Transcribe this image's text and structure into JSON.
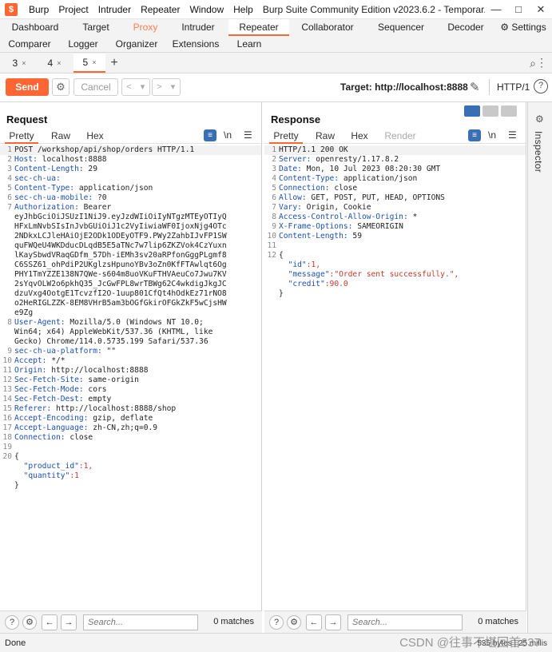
{
  "titlebar": {
    "logo": "$",
    "menu": [
      "Burp",
      "Project",
      "Intruder",
      "Repeater",
      "Window",
      "Help"
    ],
    "title": "Burp Suite Community Edition v2023.6.2 - Temporar...",
    "controls": [
      "—",
      "□",
      "✕"
    ]
  },
  "tool_tabs": {
    "row1": [
      "Dashboard",
      "Target",
      "Proxy",
      "Intruder",
      "Repeater",
      "Collaborator",
      "Sequencer",
      "Decoder",
      "Settings"
    ],
    "row2": [
      "Comparer",
      "Logger",
      "Organizer",
      "Extensions",
      "Learn"
    ],
    "active": "Repeater",
    "highlight": "Proxy",
    "accent_color": "#ff6633"
  },
  "session_tabs": {
    "tabs": [
      {
        "label": "3",
        "close": "×"
      },
      {
        "label": "4",
        "close": "×"
      },
      {
        "label": "5",
        "close": "×"
      }
    ],
    "active": "5",
    "add": "+"
  },
  "toolbar": {
    "send": "Send",
    "cancel": "Cancel",
    "target": "Target: http://localhost:8888",
    "http_version": "HTTP/1",
    "help": "?"
  },
  "request": {
    "title": "Request",
    "subtabs": [
      "Pretty",
      "Raw",
      "Hex"
    ],
    "active_subtab": "Pretty",
    "newline_toggle": "\\n",
    "lines": [
      {
        "n": "1",
        "k": "",
        "v": "POST /workshop/api/shop/orders HTTP/1.1"
      },
      {
        "n": "2",
        "k": "Host:",
        "v": " localhost:8888"
      },
      {
        "n": "3",
        "k": "Content-Length:",
        "v": " 29"
      },
      {
        "n": "4",
        "k": "sec-ch-ua:",
        "v": ""
      },
      {
        "n": "5",
        "k": "Content-Type:",
        "v": " application/json"
      },
      {
        "n": "6",
        "k": "sec-ch-ua-mobile:",
        "v": " ?0"
      },
      {
        "n": "7",
        "k": "Authorization:",
        "v": " Bearer"
      },
      {
        "n": "",
        "k": "",
        "v": "eyJhbGciOiJSUzI1NiJ9.eyJzdWIiOiIyNTgzMTEyOTIyQ"
      },
      {
        "n": "",
        "k": "",
        "v": "HFxLmNvbSIsInJvbGUiOiJ1c2VyIiwiaWF0IjoxNjg4OTc"
      },
      {
        "n": "",
        "k": "",
        "v": "2NDkxLCJleHAiOjE2ODk1ODEyOTF9.PWy2ZahbIJvFP1SW"
      },
      {
        "n": "",
        "k": "",
        "v": "quFWQeU4WKDducDLqdB5E5aTNc7w7lip6ZKZVok4CzYuxn"
      },
      {
        "n": "",
        "k": "",
        "v": "lKaySbwdVRaqGDfm_57Dh-iEMh3sv20aRPfonGggPLgmf8"
      },
      {
        "n": "",
        "k": "",
        "v": "C6SSZ61_ohPdiP2UKglzsHpunoYBv3oZn0KfFTAwlqt6Og"
      },
      {
        "n": "",
        "k": "",
        "v": "PHY1TmYZZE138N7QWe-s604m8uoVKuFTHVAeuCo7Jwu7KV"
      },
      {
        "n": "",
        "k": "",
        "v": "2sYqvOLW2o6pkhQ35_JcGwFPL8wrTBWg62C4wkdigJkgJC"
      },
      {
        "n": "",
        "k": "",
        "v": "dzuVxg4OotgE1TcvzfI2O-1uup801CfQt4hOdkEz71rNO8"
      },
      {
        "n": "",
        "k": "",
        "v": "o2HeRIGLZZK-8EM8VHrB5am3bOGfGkirOFGkZkF5wCjsHW"
      },
      {
        "n": "",
        "k": "",
        "v": "e9Zg"
      },
      {
        "n": "8",
        "k": "User-Agent:",
        "v": " Mozilla/5.0 (Windows NT 10.0;"
      },
      {
        "n": "",
        "k": "",
        "v": "Win64; x64) AppleWebKit/537.36 (KHTML, like"
      },
      {
        "n": "",
        "k": "",
        "v": "Gecko) Chrome/114.0.5735.199 Safari/537.36"
      },
      {
        "n": "9",
        "k": "sec-ch-ua-platform:",
        "v": " \"\""
      },
      {
        "n": "10",
        "k": "Accept:",
        "v": " */*"
      },
      {
        "n": "11",
        "k": "Origin:",
        "v": " http://localhost:8888"
      },
      {
        "n": "12",
        "k": "Sec-Fetch-Site:",
        "v": " same-origin"
      },
      {
        "n": "13",
        "k": "Sec-Fetch-Mode:",
        "v": " cors"
      },
      {
        "n": "14",
        "k": "Sec-Fetch-Dest:",
        "v": " empty"
      },
      {
        "n": "15",
        "k": "Referer:",
        "v": " http://localhost:8888/shop"
      },
      {
        "n": "16",
        "k": "Accept-Encoding:",
        "v": " gzip, deflate"
      },
      {
        "n": "17",
        "k": "Accept-Language:",
        "v": " zh-CN,zh;q=0.9"
      },
      {
        "n": "18",
        "k": "Connection:",
        "v": " close"
      },
      {
        "n": "19",
        "k": "",
        "v": ""
      },
      {
        "n": "20",
        "k": "",
        "v": "{"
      },
      {
        "n": "",
        "k": "",
        "v": "  ",
        "jk": "\"product_id\"",
        "jv": ":1,"
      },
      {
        "n": "",
        "k": "",
        "v": "  ",
        "jk": "\"quantity\"",
        "jv": ":1"
      },
      {
        "n": "",
        "k": "",
        "v": "}"
      }
    ],
    "search_placeholder": "Search...",
    "matches": "0 matches"
  },
  "response": {
    "title": "Response",
    "subtabs": [
      "Pretty",
      "Raw",
      "Hex",
      "Render"
    ],
    "active_subtab": "Pretty",
    "newline_toggle": "\\n",
    "lines": [
      {
        "n": "1",
        "k": "",
        "v": "HTTP/1.1 200 OK"
      },
      {
        "n": "2",
        "k": "Server:",
        "v": " openresty/1.17.8.2"
      },
      {
        "n": "3",
        "k": "Date:",
        "v": " Mon, 10 Jul 2023 08:20:30 GMT"
      },
      {
        "n": "4",
        "k": "Content-Type:",
        "v": " application/json"
      },
      {
        "n": "5",
        "k": "Connection:",
        "v": " close"
      },
      {
        "n": "6",
        "k": "Allow:",
        "v": " GET, POST, PUT, HEAD, OPTIONS"
      },
      {
        "n": "7",
        "k": "Vary:",
        "v": " Origin, Cookie"
      },
      {
        "n": "8",
        "k": "Access-Control-Allow-Origin:",
        "v": " *"
      },
      {
        "n": "9",
        "k": "X-Frame-Options:",
        "v": " SAMEORIGIN"
      },
      {
        "n": "10",
        "k": "Content-Length:",
        "v": " 59"
      },
      {
        "n": "11",
        "k": "",
        "v": ""
      },
      {
        "n": "12",
        "k": "",
        "v": "{"
      },
      {
        "n": "",
        "k": "",
        "v": "  ",
        "jk": "\"id\"",
        "jv": ":1,"
      },
      {
        "n": "",
        "k": "",
        "v": "  ",
        "jk": "\"message\"",
        "jv": ":\"Order sent successfully.\","
      },
      {
        "n": "",
        "k": "",
        "v": "  ",
        "jk": "\"credit\"",
        "jv": ":90.0"
      },
      {
        "n": "",
        "k": "",
        "v": "}"
      }
    ],
    "search_placeholder": "Search...",
    "matches": "0 matches"
  },
  "inspector": {
    "label": "Inspector"
  },
  "status": {
    "left": "Done",
    "right": "535 bytes | 25 millis",
    "watermark": "CSDN @往事不堪回首637"
  }
}
